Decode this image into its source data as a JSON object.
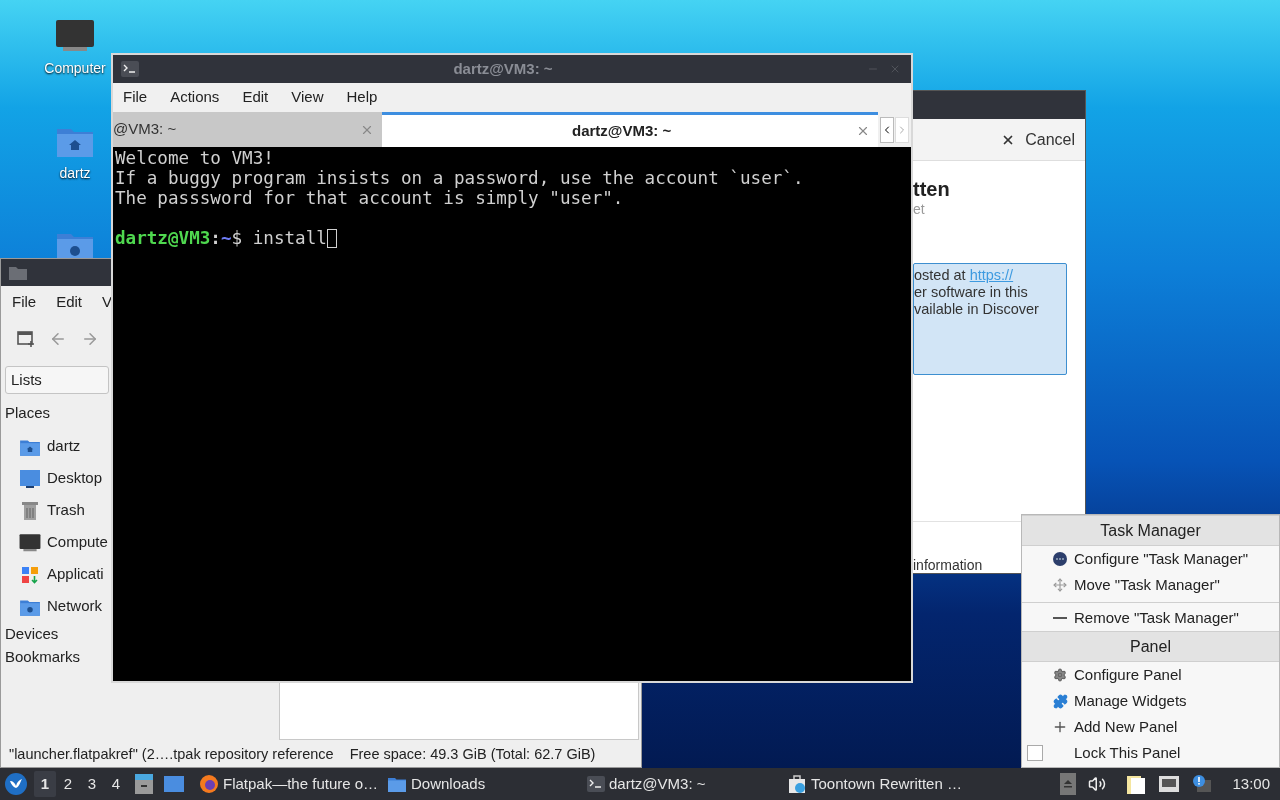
{
  "desktop_icons": [
    {
      "kind": "computer",
      "label": "Computer"
    },
    {
      "kind": "home",
      "label": "dartz"
    },
    {
      "kind": "network"
    }
  ],
  "file_manager": {
    "menu": [
      "File",
      "Edit",
      "V"
    ],
    "location_combo": "Lists",
    "places_heading": "Places",
    "places": [
      {
        "kind": "home",
        "label": "dartz"
      },
      {
        "kind": "desktop",
        "label": "Desktop"
      },
      {
        "kind": "trash",
        "label": "Trash"
      },
      {
        "kind": "computer",
        "label": "Compute"
      },
      {
        "kind": "applications",
        "label": "Applicati"
      },
      {
        "kind": "network",
        "label": "Network"
      }
    ],
    "sections": [
      "Devices",
      "Bookmarks"
    ],
    "status_bar": [
      "\"launcher.flatpakref\" (2….tpak repository reference",
      "Free space: 49.3 GiB (Total: 62.7 GiB)"
    ]
  },
  "discover": {
    "cancel": "Cancel",
    "title": "tten",
    "subtitle": "et",
    "notice_lines": [
      "osted at",
      "er software in this",
      "vailable in Discover"
    ],
    "link": "https://",
    "footer": "information"
  },
  "terminal": {
    "title": "dartz@VM3: ~",
    "menu": [
      "File",
      "Actions",
      "Edit",
      "View",
      "Help"
    ],
    "tabs": [
      {
        "label": "@VM3: ~",
        "selected": false
      },
      {
        "label": "dartz@VM3: ~",
        "selected": true
      }
    ],
    "lines": [
      {
        "kind": "output",
        "text": "Welcome to VM3!"
      },
      {
        "kind": "output",
        "text": "If a buggy program insists on a password, use the account `user`."
      },
      {
        "kind": "output",
        "text": "The passsword for that account is simply \"user\"."
      },
      {
        "kind": "prompt",
        "user": "dartz@VM3",
        "separator": ":",
        "path": "~",
        "symbol": "$",
        "command": "install"
      }
    ]
  },
  "context_menu": {
    "sections": [
      {
        "title": "Task Manager",
        "items": [
          {
            "kind": "configure-applet",
            "label": "Configure \"Task Manager\""
          },
          {
            "kind": "move",
            "label": "Move \"Task Manager\""
          },
          {
            "kind": "remove",
            "label": "Remove \"Task Manager\""
          }
        ]
      },
      {
        "title": "Panel",
        "items": [
          {
            "kind": "gear",
            "label": "Configure Panel"
          },
          {
            "kind": "widgets",
            "label": "Manage Widgets"
          },
          {
            "kind": "add",
            "label": "Add New Panel"
          },
          {
            "kind": "checkbox",
            "label": "Lock This Panel",
            "checked": false
          }
        ]
      }
    ]
  },
  "taskbar": {
    "desktops": [
      {
        "label": "1",
        "selected": true
      },
      {
        "label": "2",
        "selected": false
      },
      {
        "label": "3",
        "selected": false
      },
      {
        "label": "4",
        "selected": false
      }
    ],
    "tasks": [
      {
        "kind": "browser",
        "label": "Flatpak—the future o…"
      },
      {
        "kind": "folder",
        "label": "Downloads"
      },
      {
        "kind": "terminal",
        "label": "dartz@VM3: ~"
      },
      {
        "kind": "store",
        "label": "Toontown Rewritten …"
      }
    ],
    "clock": "13:00"
  }
}
